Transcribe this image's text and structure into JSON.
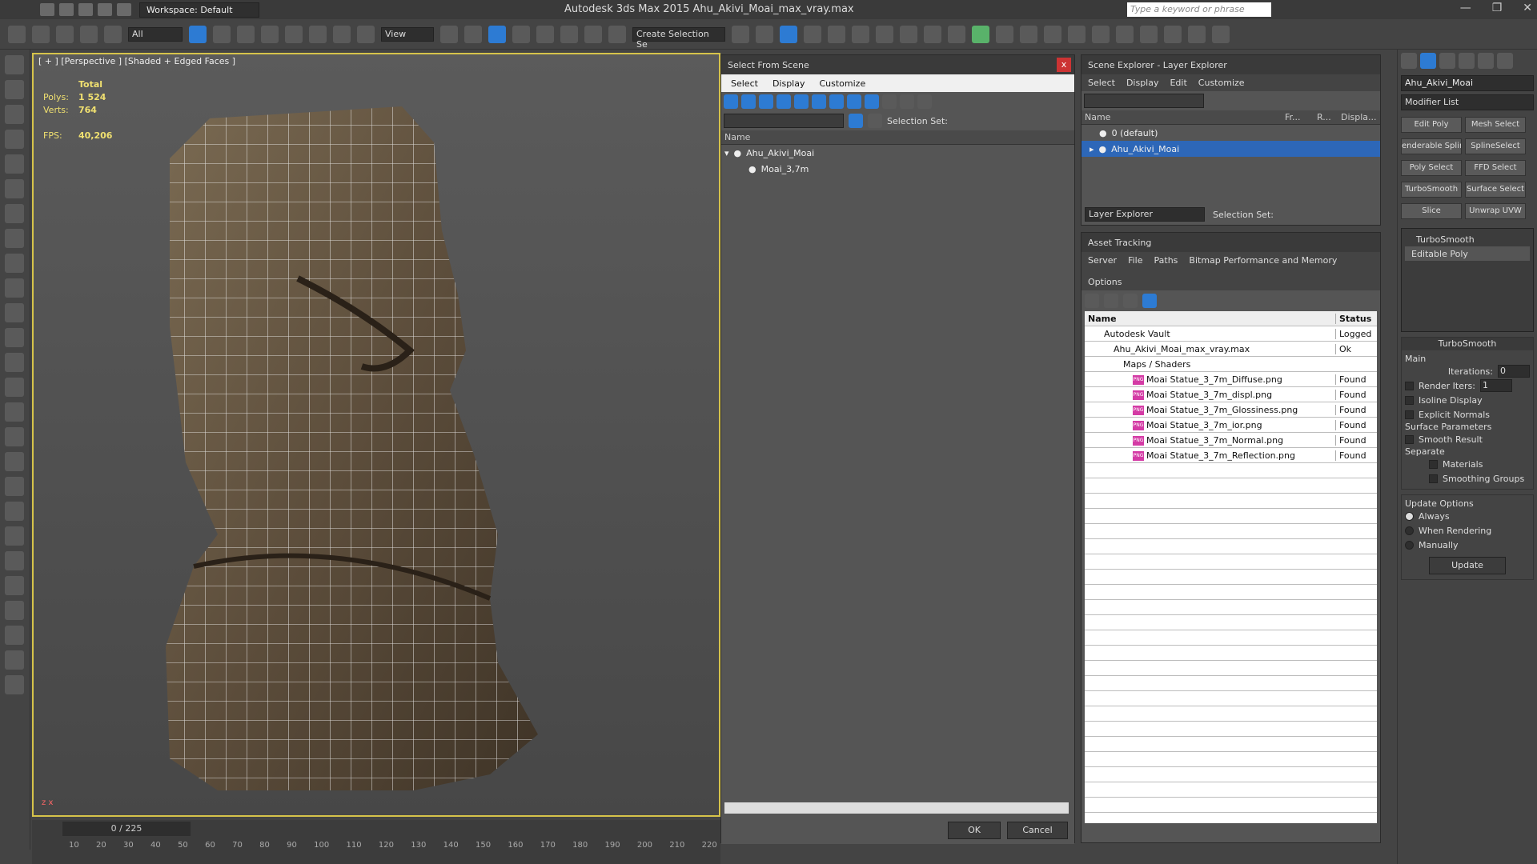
{
  "app": {
    "title": "Autodesk 3ds Max  2015    Ahu_Akivi_Moai_max_vray.max",
    "workspace": "Workspace: Default",
    "search_placeholder": "Type a keyword or phrase",
    "win_min": "—",
    "win_max": "❐",
    "win_close": "✕"
  },
  "toolbar": {
    "filter": "All",
    "view": "View",
    "create_selection": "Create Selection Se"
  },
  "viewport": {
    "label": "[ + ] [Perspective ] [Shaded + Edged Faces ]",
    "stats_total": "Total",
    "polys_label": "Polys:",
    "polys_value": "1 524",
    "verts_label": "Verts:",
    "verts_value": "764",
    "fps_label": "FPS:",
    "fps_value": "40,206",
    "axis_x": "x",
    "axis_z": "z"
  },
  "timeline": {
    "frame": "0 / 225",
    "ticks": [
      "10",
      "20",
      "30",
      "40",
      "50",
      "60",
      "70",
      "80",
      "90",
      "100",
      "110",
      "120",
      "130",
      "140",
      "150",
      "160",
      "170",
      "180",
      "190",
      "200",
      "210",
      "220"
    ]
  },
  "select_from_scene": {
    "title": "Select From Scene",
    "close": "x",
    "menu": [
      "Select",
      "Display",
      "Customize"
    ],
    "selection_set_label": "Selection Set:",
    "col_name": "Name",
    "tree": [
      {
        "label": "Ahu_Akivi_Moai",
        "level": 0
      },
      {
        "label": "Moai_3,7m",
        "level": 1
      }
    ],
    "ok": "OK",
    "cancel": "Cancel"
  },
  "scene_explorer": {
    "title": "Scene Explorer - Layer Explorer",
    "menu": [
      "Select",
      "Display",
      "Edit",
      "Customize"
    ],
    "cols": [
      "Name",
      "Fr...",
      "R...",
      "Displa..."
    ],
    "rows": [
      {
        "label": "0 (default)",
        "selected": false
      },
      {
        "label": "Ahu_Akivi_Moai",
        "selected": true
      }
    ],
    "footer_dropdown": "Layer Explorer",
    "selection_set_label": "Selection Set:"
  },
  "asset_tracking": {
    "title": "Asset Tracking",
    "menu": [
      "Server",
      "File",
      "Paths",
      "Bitmap Performance and Memory",
      "Options"
    ],
    "col_name": "Name",
    "col_status": "Status",
    "rows": [
      {
        "name": "Autodesk Vault",
        "status": "Logged",
        "indent": 2
      },
      {
        "name": "Ahu_Akivi_Moai_max_vray.max",
        "status": "Ok",
        "indent": 3
      },
      {
        "name": "Maps / Shaders",
        "status": "",
        "indent": 4
      },
      {
        "name": "Moai Statue_3_7m_Diffuse.png",
        "status": "Found",
        "indent": 5
      },
      {
        "name": "Moai Statue_3_7m_displ.png",
        "status": "Found",
        "indent": 5
      },
      {
        "name": "Moai Statue_3_7m_Glossiness.png",
        "status": "Found",
        "indent": 5
      },
      {
        "name": "Moai Statue_3_7m_ior.png",
        "status": "Found",
        "indent": 5
      },
      {
        "name": "Moai Statue_3_7m_Normal.png",
        "status": "Found",
        "indent": 5
      },
      {
        "name": "Moai Statue_3_7m_Reflection.png",
        "status": "Found",
        "indent": 5
      }
    ]
  },
  "command_panel": {
    "object_name": "Ahu_Akivi_Moai",
    "modifier_list": "Modifier List",
    "mod_buttons": [
      "Edit Poly",
      "Mesh Select",
      "enderable Splir",
      "SplineSelect",
      "Poly Select",
      "FFD Select",
      "TurboSmooth",
      "Surface Select",
      "Slice",
      "Unwrap UVW"
    ],
    "stack": [
      "TurboSmooth",
      "Editable Poly"
    ],
    "rollout_title": "TurboSmooth",
    "main_label": "Main",
    "iterations_label": "Iterations:",
    "iterations_value": "0",
    "render_iters_label": "Render Iters:",
    "render_iters_value": "1",
    "isoline": "Isoline Display",
    "explicit_normals": "Explicit Normals",
    "surface_params": "Surface Parameters",
    "smooth_result": "Smooth Result",
    "separate": "Separate",
    "materials": "Materials",
    "smoothing_groups": "Smoothing Groups",
    "update_options": "Update Options",
    "always": "Always",
    "when_rendering": "When Rendering",
    "manually": "Manually",
    "update": "Update"
  }
}
